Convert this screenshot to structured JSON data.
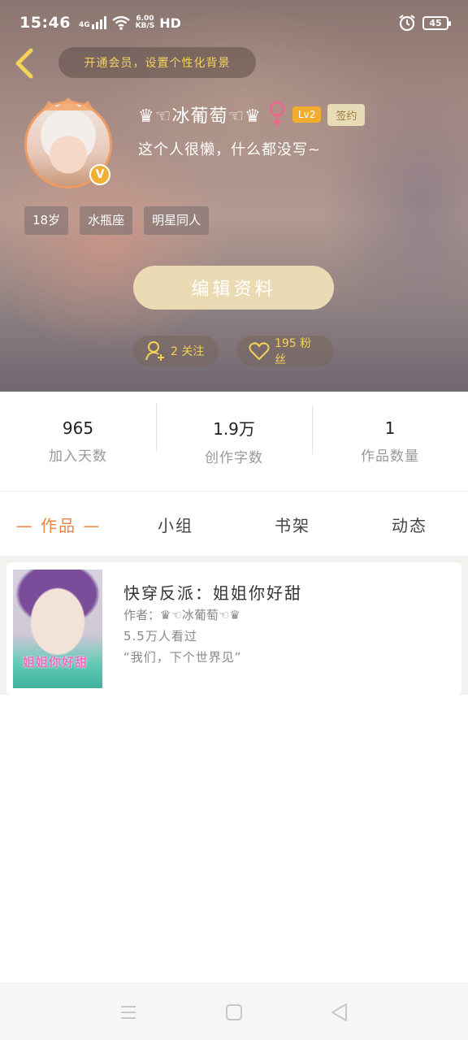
{
  "status_bar": {
    "time": "15:46",
    "network": "4G",
    "speed_value": "6.00",
    "speed_unit": "KB/S",
    "hd": "HD",
    "battery": "45"
  },
  "header": {
    "vip_prompt": "开通会员，设置个性化背景"
  },
  "profile": {
    "username": "♛☜冰葡萄☜♛",
    "level": "Lv2",
    "signed_label": "签约",
    "bio": "这个人很懒，什么都没写~",
    "verified_badge": "V",
    "tags": [
      "18岁",
      "水瓶座",
      "明星同人"
    ],
    "edit_label": "编辑资料",
    "following_label": "2 关注",
    "fans_label": "195 粉丝"
  },
  "stats": [
    {
      "value": "965",
      "label": "加入天数"
    },
    {
      "value": "1.9万",
      "label": "创作字数"
    },
    {
      "value": "1",
      "label": "作品数量"
    }
  ],
  "tabs": [
    "— 作品 —",
    "小组",
    "书架",
    "动态"
  ],
  "works": [
    {
      "title": "快穿反派：姐姐你好甜",
      "author": "作者：♛☜冰葡萄☜♛",
      "views": "5.5万人看过",
      "quote": "“我们，下个世界见”",
      "cover_text": "姐姐你好甜"
    }
  ],
  "colors": {
    "accent": "#ee8448",
    "gold": "#f4d25a",
    "edit_button": "#eadbb5",
    "level_badge": "#f2ad2e"
  },
  "icons": {
    "back": "chevron-left-icon",
    "alarm": "alarm-icon",
    "wifi": "wifi-icon",
    "signal": "signal-icon",
    "gender": "female-icon",
    "follow": "user-add-icon",
    "fans": "heart-icon",
    "nav_menu": "menu-icon",
    "nav_home": "square-icon",
    "nav_back": "triangle-back-icon"
  }
}
